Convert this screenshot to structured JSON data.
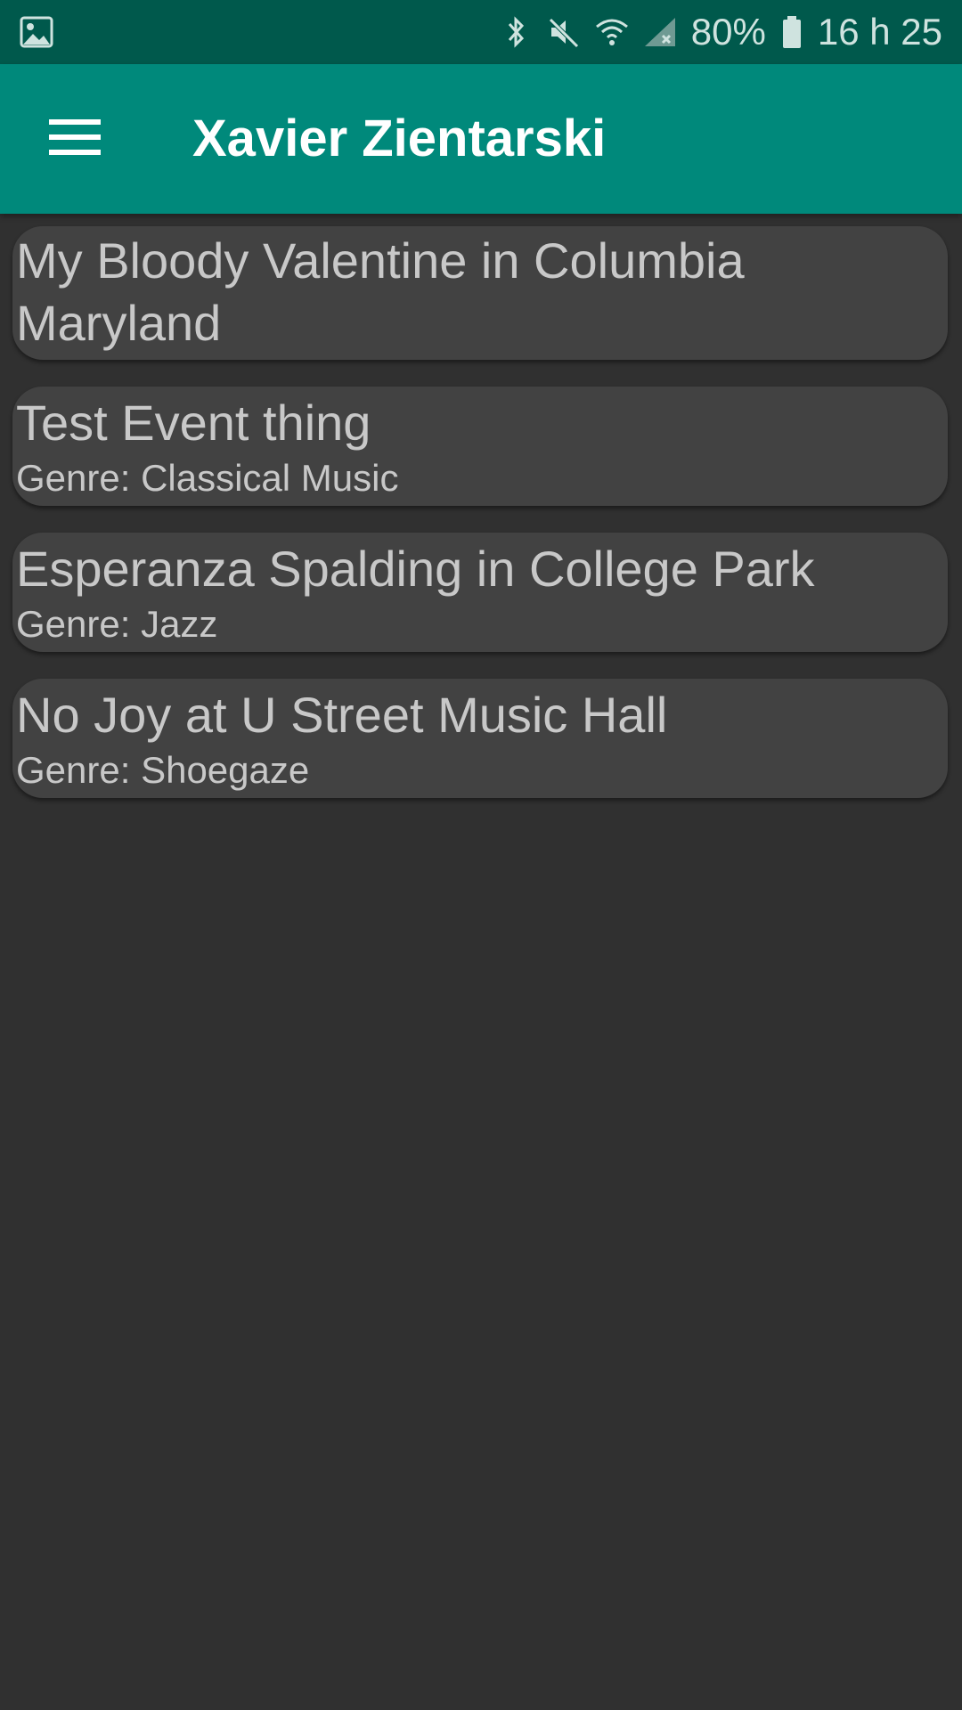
{
  "status_bar": {
    "left_icon": "image-icon",
    "icons": [
      "bluetooth-icon",
      "mute-icon",
      "wifi-icon",
      "signal-icon",
      "battery-icon"
    ],
    "battery": "80%",
    "time": "16 h 25"
  },
  "app_bar": {
    "menu_icon": "hamburger-menu-icon",
    "title": "Xavier Zientarski",
    "color": "#00897b"
  },
  "events": [
    {
      "title": "My Bloody Valentine in Columbia Maryland",
      "genre": ""
    },
    {
      "title": "Test Event thing",
      "genre": "Genre: Classical Music"
    },
    {
      "title": "Esperanza Spalding in College Park",
      "genre": "Genre: Jazz"
    },
    {
      "title": "No Joy at U Street Music Hall",
      "genre": "Genre: Shoegaze"
    }
  ],
  "colors": {
    "status_bar": "#00594c",
    "background": "#303030",
    "card": "#424242",
    "text": "#c8c8c8"
  }
}
